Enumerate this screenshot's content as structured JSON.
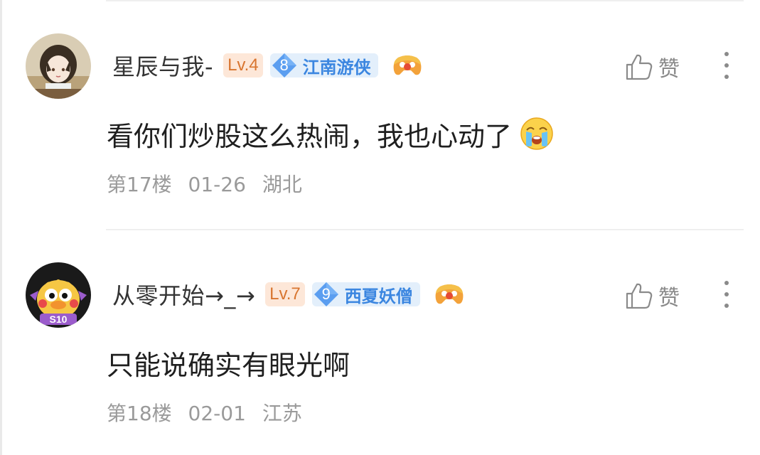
{
  "comments": [
    {
      "username": "星辰与我-",
      "level": "Lv.4",
      "title_rank": "8",
      "title_text": "江南游侠",
      "text": "看你们炒股这么热闹，我也心动了",
      "floor": "第17楼",
      "date": "01-26",
      "location": "湖北",
      "like_label": "赞",
      "avatar_icon": "anime-girl-avatar",
      "emoji_icon": "crying-face-emoji"
    },
    {
      "username": "从零开始→_→",
      "level": "Lv.7",
      "title_rank": "9",
      "title_text": "西夏妖僧",
      "text": "只能说确实有眼光啊",
      "floor": "第18楼",
      "date": "02-01",
      "location": "江苏",
      "like_label": "赞",
      "avatar_icon": "cartoon-duck-avatar",
      "avatar_text": "S10"
    }
  ],
  "colors": {
    "level_bg": "#fde7d8",
    "level_fg": "#d8752f",
    "title_bg": "#e3effb",
    "title_fg": "#3b86e0",
    "text": "#1f1f1f",
    "meta": "#9a9a9a"
  }
}
